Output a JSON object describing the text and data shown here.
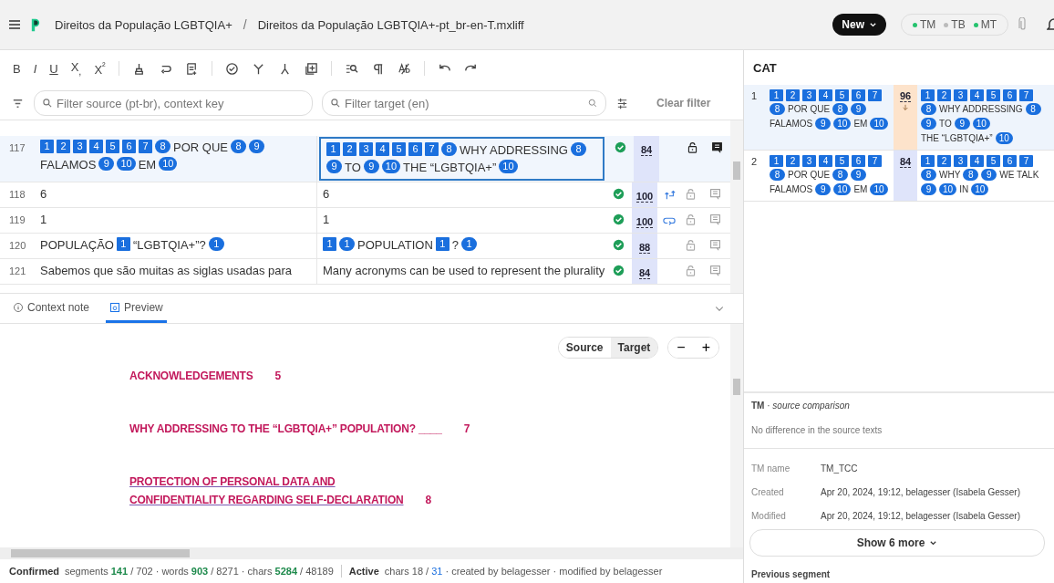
{
  "header": {
    "breadcrumb_separator": "/",
    "breadcrumb": [
      "Direitos da População LGBTQIA+",
      "Direitos da População LGBTQIA+-pt_br-en-T.mxliff"
    ],
    "new_button": "New",
    "resources": [
      {
        "label": "TM",
        "on": true
      },
      {
        "label": "TB",
        "on": false
      },
      {
        "label": "MT",
        "on": true
      }
    ]
  },
  "format_buttons": [
    "B",
    "I",
    "U",
    "X$_{,}$",
    "X$^{²}$"
  ],
  "filters": {
    "source_placeholder": "Filter source (pt-br), context key",
    "target_placeholder": "Filter target (en)",
    "clear": "Clear filter"
  },
  "segments": [
    {
      "number": "117",
      "selected": true,
      "confirmed": true,
      "score": "84",
      "kind": "plain",
      "source": [
        {
          "kind": "box",
          "text": "1"
        },
        {
          "kind": "box",
          "text": "2"
        },
        {
          "kind": "box",
          "text": "3"
        },
        {
          "kind": "box",
          "text": "4"
        },
        {
          "kind": "box",
          "text": "5"
        },
        {
          "kind": "box",
          "text": "6"
        },
        {
          "kind": "box",
          "text": "7"
        },
        {
          "kind": "pill",
          "text": "8"
        },
        {
          "kind": "text",
          "text": "POR QUE"
        },
        {
          "kind": "pill",
          "text": "8"
        },
        {
          "kind": "pill",
          "text": "9"
        },
        {
          "kind": "text",
          "text": "FALAMOS"
        },
        {
          "kind": "pill",
          "text": "9"
        },
        {
          "kind": "pill",
          "text": "10"
        },
        {
          "kind": "text",
          "text": "EM"
        },
        {
          "kind": "pill",
          "text": "10"
        }
      ],
      "target": [
        {
          "kind": "box",
          "text": "1"
        },
        {
          "kind": "box",
          "text": "2"
        },
        {
          "kind": "box",
          "text": "3"
        },
        {
          "kind": "box",
          "text": "4"
        },
        {
          "kind": "box",
          "text": "5"
        },
        {
          "kind": "box",
          "text": "6"
        },
        {
          "kind": "box",
          "text": "7"
        },
        {
          "kind": "pill",
          "text": "8"
        },
        {
          "kind": "text",
          "text": "WHY ADDRESSING"
        },
        {
          "kind": "pill",
          "text": "8"
        },
        {
          "kind": "pill",
          "text": "9"
        },
        {
          "kind": "text",
          "text": "TO"
        },
        {
          "kind": "pill",
          "text": "9"
        },
        {
          "kind": "pill",
          "text": "10"
        },
        {
          "kind": "text",
          "text": "THE “LGBTQIA+”"
        },
        {
          "kind": "pill",
          "text": "10"
        }
      ]
    },
    {
      "number": "118",
      "selected": false,
      "confirmed": true,
      "score": "100",
      "kind": "branch",
      "source": [
        {
          "kind": "text",
          "text": "6"
        }
      ],
      "target": [
        {
          "kind": "text",
          "text": "6"
        }
      ]
    },
    {
      "number": "119",
      "selected": false,
      "confirmed": true,
      "score": "100",
      "kind": "loop",
      "source": [
        {
          "kind": "text",
          "text": "1"
        }
      ],
      "target": [
        {
          "kind": "text",
          "text": "1"
        }
      ]
    },
    {
      "number": "120",
      "selected": false,
      "confirmed": true,
      "score": "88",
      "kind": "plain",
      "source": [
        {
          "kind": "text",
          "text": "POPULAÇÃO"
        },
        {
          "kind": "box",
          "text": "1"
        },
        {
          "kind": "text",
          "text": "“LGBTQIA+”?"
        },
        {
          "kind": "pill",
          "text": "1"
        }
      ],
      "target": [
        {
          "kind": "box",
          "text": "1"
        },
        {
          "kind": "pill",
          "text": "1"
        },
        {
          "kind": "text",
          "text": "POPULATION"
        },
        {
          "kind": "box",
          "text": "1"
        },
        {
          "kind": "text",
          "text": "?"
        },
        {
          "kind": "pill",
          "text": "1"
        }
      ]
    },
    {
      "number": "121",
      "selected": false,
      "confirmed": true,
      "score": "84",
      "kind": "plain",
      "source": [
        {
          "kind": "text",
          "text": "Sabemos que são muitas as siglas usadas para"
        }
      ],
      "target": [
        {
          "kind": "text",
          "text": "Many acronyms can be used to represent the plurality"
        }
      ]
    }
  ],
  "bottom_tabs": [
    {
      "label": "Context note",
      "kind": "info",
      "selected": false
    },
    {
      "label": "Preview",
      "kind": "preview",
      "selected": true
    }
  ],
  "preview": {
    "toggle": [
      {
        "label": "Source",
        "selected": false
      },
      {
        "label": "Target",
        "selected": true
      }
    ],
    "zoom": [
      "−",
      "+"
    ],
    "entries": [
      {
        "lines": [
          "ACKNOWLEDGEMENTS"
        ],
        "page": "5",
        "underlined": false
      },
      {
        "lines": [
          "WHY ADDRESSING TO THE “LGBTQIA+” POPULATION? ____"
        ],
        "page": "7",
        "underlined": false
      },
      {
        "lines": [
          "PROTECTION OF PERSONAL DATA AND",
          "CONFIDENTIALITY REGARDING SELF-DECLARATION"
        ],
        "page": "8",
        "underlined": true
      }
    ]
  },
  "status_bar": {
    "confirmed_label": "Confirmed",
    "confirmed": "segments **141** / 702 · words **903** / 8271 · chars **5284** / 48189",
    "active_label": "Active",
    "active": "chars 18 / **31** · created by belagesser · modified by belagesser"
  },
  "cat": {
    "title": "CAT",
    "matches": [
      {
        "number": "1",
        "selected": true,
        "score": "96",
        "color": "#fde3cb",
        "arrow": true,
        "source": [
          {
            "kind": "box",
            "text": "1"
          },
          {
            "kind": "box",
            "text": "2"
          },
          {
            "kind": "box",
            "text": "3"
          },
          {
            "kind": "box",
            "text": "4"
          },
          {
            "kind": "box",
            "text": "5"
          },
          {
            "kind": "box",
            "text": "6"
          },
          {
            "kind": "box",
            "text": "7"
          },
          {
            "kind": "pill",
            "text": "8"
          },
          {
            "kind": "text",
            "text": "POR QUE"
          },
          {
            "kind": "pill",
            "text": "8"
          },
          {
            "kind": "pill",
            "text": "9"
          },
          {
            "kind": "text",
            "text": "FALAMOS"
          },
          {
            "kind": "pill",
            "text": "9"
          },
          {
            "kind": "pill",
            "text": "10"
          },
          {
            "kind": "text",
            "text": "EM"
          },
          {
            "kind": "pill",
            "text": "10"
          }
        ],
        "target": [
          {
            "kind": "box",
            "text": "1"
          },
          {
            "kind": "box",
            "text": "2"
          },
          {
            "kind": "box",
            "text": "3"
          },
          {
            "kind": "box",
            "text": "4"
          },
          {
            "kind": "box",
            "text": "5"
          },
          {
            "kind": "box",
            "text": "6"
          },
          {
            "kind": "box",
            "text": "7"
          },
          {
            "kind": "pill",
            "text": "8"
          },
          {
            "kind": "text",
            "text": "WHY ADDRESSING"
          },
          {
            "kind": "pill",
            "text": "8"
          },
          {
            "kind": "pill",
            "text": "9"
          },
          {
            "kind": "text",
            "text": "TO"
          },
          {
            "kind": "pill",
            "text": "9"
          },
          {
            "kind": "pill",
            "text": "10"
          },
          {
            "kind": "text",
            "text": "THE “LGBTQIA+”"
          },
          {
            "kind": "pill",
            "text": "10"
          }
        ]
      },
      {
        "number": "2",
        "selected": false,
        "score": "84",
        "color": "#dfe4fa",
        "arrow": false,
        "source": [
          {
            "kind": "box",
            "text": "1"
          },
          {
            "kind": "box",
            "text": "2"
          },
          {
            "kind": "box",
            "text": "3"
          },
          {
            "kind": "box",
            "text": "4"
          },
          {
            "kind": "box",
            "text": "5"
          },
          {
            "kind": "box",
            "text": "6"
          },
          {
            "kind": "box",
            "text": "7"
          },
          {
            "kind": "pill",
            "text": "8"
          },
          {
            "kind": "text",
            "text": "POR QUE"
          },
          {
            "kind": "pill",
            "text": "8"
          },
          {
            "kind": "pill",
            "text": "9"
          },
          {
            "kind": "text",
            "text": "FALAMOS"
          },
          {
            "kind": "pill",
            "text": "9"
          },
          {
            "kind": "pill",
            "text": "10"
          },
          {
            "kind": "text",
            "text": "EM"
          },
          {
            "kind": "pill",
            "text": "10"
          }
        ],
        "target": [
          {
            "kind": "box",
            "text": "1"
          },
          {
            "kind": "box",
            "text": "2"
          },
          {
            "kind": "box",
            "text": "3"
          },
          {
            "kind": "box",
            "text": "4"
          },
          {
            "kind": "box",
            "text": "5"
          },
          {
            "kind": "box",
            "text": "6"
          },
          {
            "kind": "box",
            "text": "7"
          },
          {
            "kind": "pill",
            "text": "8"
          },
          {
            "kind": "text",
            "text": "WHY"
          },
          {
            "kind": "pill",
            "text": "8"
          },
          {
            "kind": "pill",
            "text": "9"
          },
          {
            "kind": "text",
            "text": "WE TALK"
          },
          {
            "kind": "pill",
            "text": "9"
          },
          {
            "kind": "pill",
            "text": "10"
          },
          {
            "kind": "text",
            "text": "IN"
          },
          {
            "kind": "pill",
            "text": "10"
          }
        ]
      }
    ],
    "comparison_title": "**TM** · *source comparison*",
    "comparison_text": "No difference in the source texts",
    "details": [
      {
        "label": "TM name",
        "value": "TM_TCC"
      },
      {
        "label": "Created",
        "value": "Apr 20, 2024, 19:12, belagesser (Isabela Gesser)"
      },
      {
        "label": "Modified",
        "value": "Apr 20, 2024, 19:12, belagesser (Isabela Gesser)"
      }
    ],
    "show_more": "Show 6 more",
    "previous_segment": "Previous segment"
  }
}
